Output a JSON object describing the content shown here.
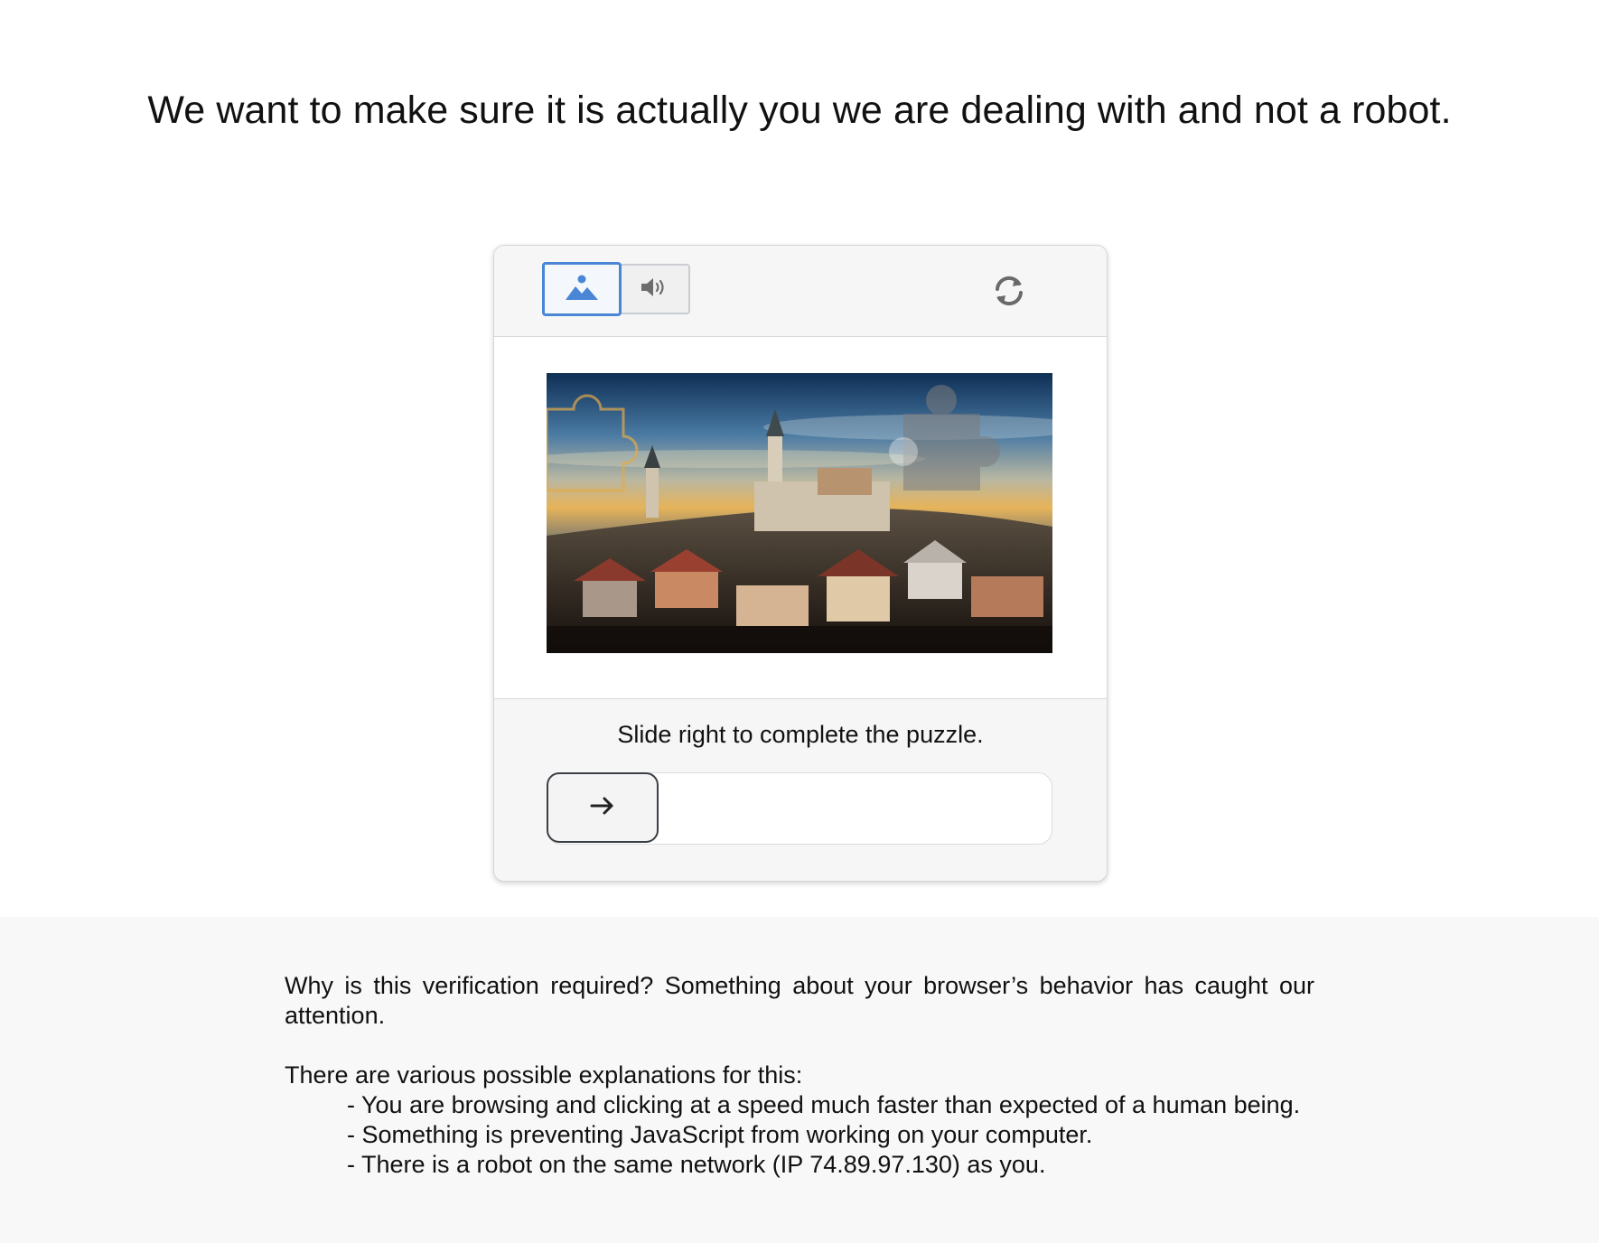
{
  "headline": "We want to make sure it is actually you we are dealing with and not a robot.",
  "captcha": {
    "mode_buttons": [
      {
        "name": "image-challenge",
        "icon": "image-icon",
        "selected": true
      },
      {
        "name": "audio-challenge",
        "icon": "speaker-icon",
        "selected": false
      }
    ],
    "refresh_icon": "refresh-icon",
    "instruction": "Slide right to complete the puzzle.",
    "slider_arrow_icon": "arrow-right-icon",
    "slider_progress": 0,
    "accent_color": "#4a86d6"
  },
  "info": {
    "question": "Why is this verification required? Something about your browser’s behavior has caught our attention.",
    "explanations_intro": "There are various possible explanations for this:",
    "reasons": [
      "- You are browsing and clicking at a speed much faster than expected of a human being.",
      "- Something is preventing JavaScript from working on your computer.",
      "- There is a robot on the same network (IP 74.89.97.130) as you."
    ]
  }
}
